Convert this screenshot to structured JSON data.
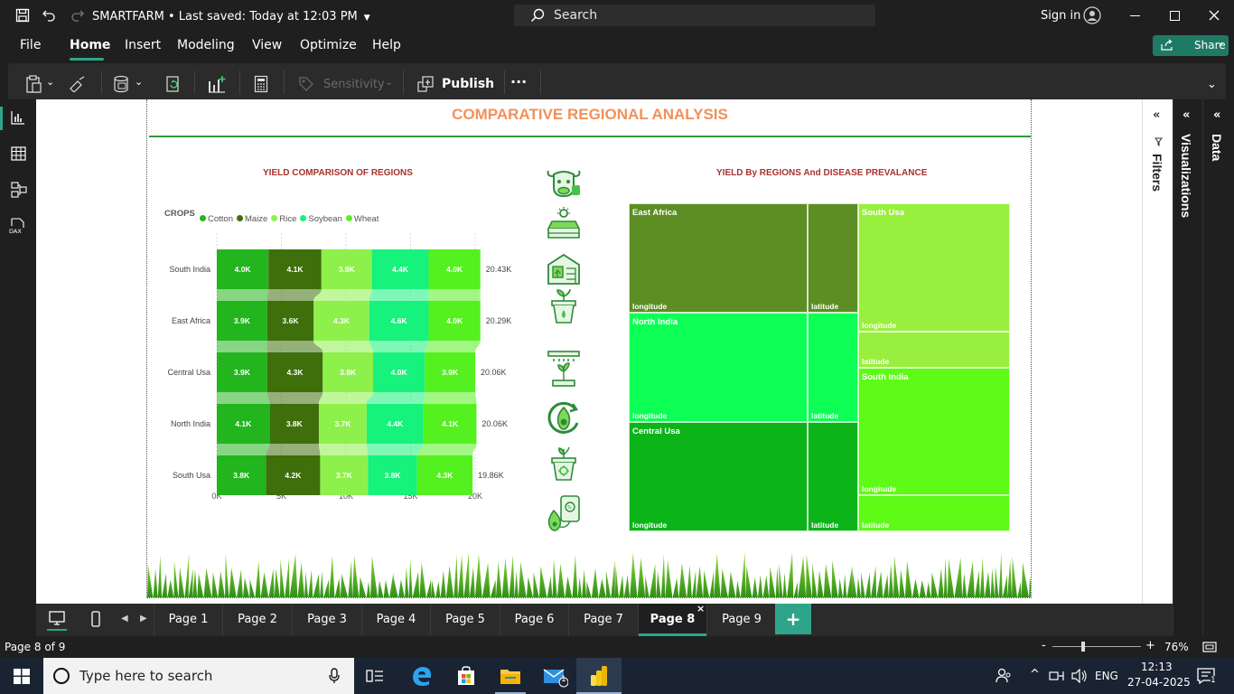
{
  "app": {
    "title": "SMARTFARM",
    "saved_status": "Last saved: Today at 12:03 PM",
    "search_label": "Search",
    "sign_in": "Sign in",
    "share_label": "Share"
  },
  "menu": [
    "File",
    "Home",
    "Insert",
    "Modeling",
    "View",
    "Optimize",
    "Help"
  ],
  "ribbon": {
    "sensitivity": "Sensitivity",
    "publish": "Publish",
    "more": "···"
  },
  "report": {
    "title": "COMPARATIVE REGIONAL ANALYSIS",
    "left_chart_title": "YIELD COMPARISON OF REGIONS",
    "right_chart_title": "YIELD By REGIONS And DISEASE PREVALANCE",
    "legend_title": "CROPS"
  },
  "chart_data": [
    {
      "type": "bar",
      "orientation": "horizontal-stacked",
      "title": "YIELD COMPARISON OF REGIONS",
      "legend_title": "CROPS",
      "legend_position": "top-left",
      "categories": [
        "South India",
        "East Africa",
        "Central Usa",
        "North India",
        "South Usa"
      ],
      "series": [
        {
          "name": "Cotton",
          "color": "#22b51e",
          "values": [
            4.0,
            3.9,
            3.9,
            4.1,
            3.8
          ],
          "labels": [
            "4.0K",
            "3.9K",
            "3.9K",
            "4.1K",
            "3.8K"
          ]
        },
        {
          "name": "Maize",
          "color": "#3e6f0b",
          "values": [
            4.1,
            3.6,
            4.3,
            3.8,
            4.2
          ],
          "labels": [
            "4.1K",
            "3.6K",
            "4.3K",
            "3.8K",
            "4.2K"
          ]
        },
        {
          "name": "Rice",
          "color": "#8ef04a",
          "values": [
            3.9,
            4.3,
            3.9,
            3.7,
            3.7
          ],
          "labels": [
            "3.9K",
            "4.3K",
            "3.9K",
            "3.7K",
            "3.7K"
          ]
        },
        {
          "name": "Soybean",
          "color": "#16f27c",
          "values": [
            4.4,
            4.6,
            4.0,
            4.4,
            3.8
          ],
          "labels": [
            "4.4K",
            "4.6K",
            "4.0K",
            "4.4K",
            "3.8K"
          ]
        },
        {
          "name": "Wheat",
          "color": "#55f020",
          "values": [
            4.0,
            4.0,
            3.9,
            4.1,
            4.3
          ],
          "labels": [
            "4.0K",
            "4.0K",
            "3.9K",
            "4.1K",
            "4.3K"
          ]
        }
      ],
      "totals": [
        "20.43K",
        "20.29K",
        "20.06K",
        "20.06K",
        "19.86K"
      ],
      "x_ticks": [
        "0K",
        "5K",
        "10K",
        "15K",
        "20K"
      ],
      "xlim": [
        0,
        20
      ],
      "unit": "K"
    },
    {
      "type": "treemap",
      "title": "YIELD By REGIONS And DISEASE PREVALANCE",
      "groups": [
        {
          "name": "East Africa",
          "color": "#5c8e23",
          "children": [
            {
              "name": "longitude",
              "value": 70
            },
            {
              "name": "latitude",
              "value": 20
            }
          ]
        },
        {
          "name": "North India",
          "color": "#0dff55",
          "children": [
            {
              "name": "longitude",
              "value": 70
            },
            {
              "name": "latitude",
              "value": 20
            }
          ]
        },
        {
          "name": "Central Usa",
          "color": "#0cb41a",
          "children": [
            {
              "name": "longitude",
              "value": 70
            },
            {
              "name": "latitude",
              "value": 20
            }
          ]
        },
        {
          "name": "South Usa",
          "color": "#99ef3d",
          "children": [
            {
              "name": "longitude",
              "value": 70
            },
            {
              "name": "latitude",
              "value": 20
            }
          ]
        },
        {
          "name": "South India",
          "color": "#5dfb16",
          "children": [
            {
              "name": "longitude",
              "value": 70
            },
            {
              "name": "latitude",
              "value": 20
            }
          ]
        }
      ]
    }
  ],
  "icons": [
    "cow-icon",
    "crop-field-icon",
    "greenhouse-icon",
    "plant-pot-icon",
    "sprinkler-icon",
    "avocado-cycle-icon",
    "seedling-pot-icon",
    "phone-avocado-icon"
  ],
  "panes": {
    "filters": "Filters",
    "visualizations": "Visualizations",
    "data": "Data"
  },
  "pages": [
    "Page 1",
    "Page 2",
    "Page 3",
    "Page 4",
    "Page 5",
    "Page 6",
    "Page 7",
    "Page 8",
    "Page 9"
  ],
  "active_page": "Page 8",
  "status": {
    "page_indicator": "Page 8 of 9",
    "zoom": "76%"
  },
  "taskbar": {
    "search_placeholder": "Type here to search",
    "language": "ENG",
    "time": "12:13",
    "date": "27-04-2025",
    "notif_count": "1"
  }
}
